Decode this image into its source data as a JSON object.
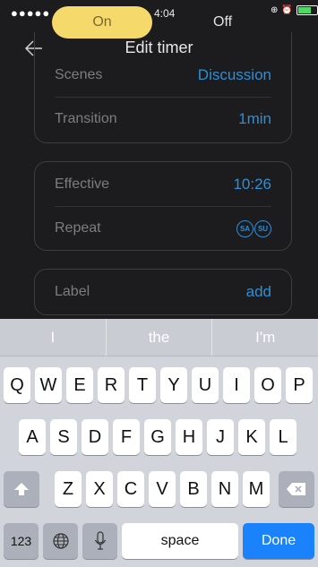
{
  "status_bar": {
    "signal": "●●●●●",
    "time": "4:04"
  },
  "toggle": {
    "on_label": "On",
    "off_label": "Off"
  },
  "nav": {
    "title": "Edit timer"
  },
  "settings": {
    "scenes": {
      "label": "Scenes",
      "value": "Discussion"
    },
    "transition": {
      "label": "Transition",
      "value": "1min"
    },
    "effective": {
      "label": "Effective",
      "value": "10:26"
    },
    "repeat": {
      "label": "Repeat",
      "days": [
        "SA",
        "SU"
      ]
    },
    "label": {
      "label": "Label",
      "value": "add"
    }
  },
  "suggestions": [
    "I",
    "the",
    "I'm"
  ],
  "keyboard": {
    "row1": [
      "Q",
      "W",
      "E",
      "R",
      "T",
      "Y",
      "U",
      "I",
      "O",
      "P"
    ],
    "row2": [
      "A",
      "S",
      "D",
      "F",
      "G",
      "H",
      "J",
      "K",
      "L"
    ],
    "row3": [
      "Z",
      "X",
      "C",
      "V",
      "B",
      "N",
      "M"
    ],
    "numbers_label": "123",
    "space_label": "space",
    "done_label": "Done"
  },
  "colors": {
    "accent": "#2f8ed4",
    "toggle_on": "#f6d96b",
    "done_key": "#1a82fb"
  }
}
